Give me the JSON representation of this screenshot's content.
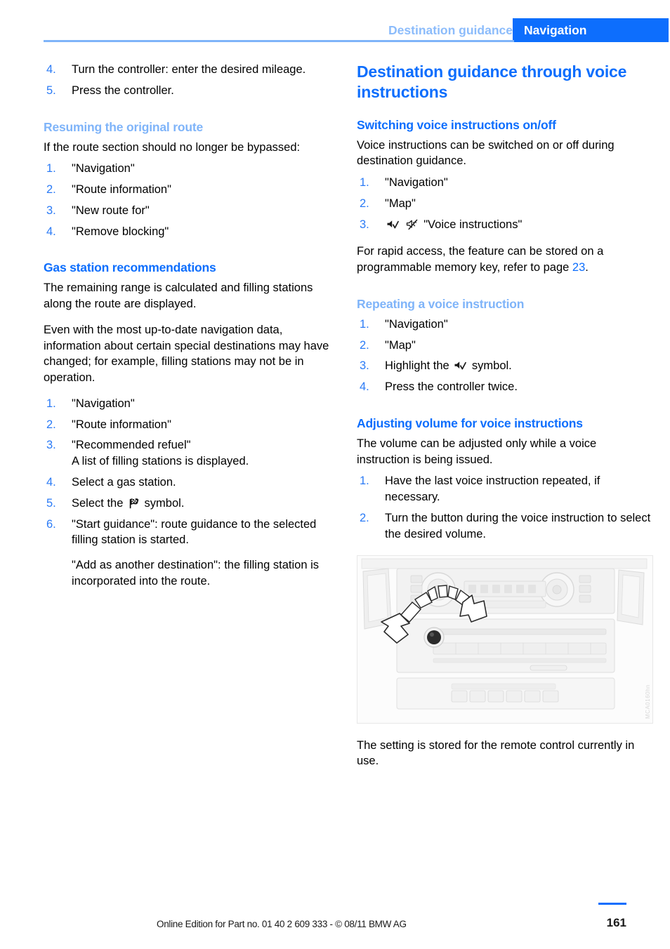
{
  "header": {
    "chapter": "Destination guidance",
    "section": "Navigation",
    "section_bg": "#0d6efd",
    "chapter_color": "#8cbcfb"
  },
  "colors": {
    "heading_blue": "#0d6efd",
    "heading_blue_light": "#7fb4f9",
    "list_number_blue": "#2b7bf6",
    "rule_blue": "#7fb4f9"
  },
  "left_column": {
    "continued_steps": [
      {
        "num": "4.",
        "text": "Turn the controller: enter the desired mileage."
      },
      {
        "num": "5.",
        "text": "Press the controller."
      }
    ],
    "resuming": {
      "heading": "Resuming the original route",
      "intro": "If the route section should no longer be bypassed:",
      "steps": [
        {
          "num": "1.",
          "text": "\"Navigation\""
        },
        {
          "num": "2.",
          "text": "\"Route information\""
        },
        {
          "num": "3.",
          "text": "\"New route for\""
        },
        {
          "num": "4.",
          "text": "\"Remove blocking\""
        }
      ]
    },
    "gas_station": {
      "heading": "Gas station recommendations",
      "para1": "The remaining range is calculated and filling stations along the route are displayed.",
      "para2": "Even with the most up-to-date navigation data, information about certain special destinations may have changed; for example, filling stations may not be in operation.",
      "steps": [
        {
          "num": "1.",
          "text": "\"Navigation\""
        },
        {
          "num": "2.",
          "text": "\"Route information\""
        },
        {
          "num": "3.",
          "text": "\"Recommended refuel\"",
          "sub": "A list of filling stations is displayed."
        },
        {
          "num": "4.",
          "text": "Select a gas station."
        },
        {
          "num": "5.",
          "text_before_icon": "Select the ",
          "icon": "fuel-flag-icon",
          "text_after_icon": " symbol."
        },
        {
          "num": "6.",
          "text": "\"Start guidance\": route guidance to the selected filling station is started.",
          "sub_para": "\"Add as another destination\": the filling station is incorporated into the route."
        }
      ]
    }
  },
  "right_column": {
    "title": "Destination guidance through voice instructions",
    "switching": {
      "heading": "Switching voice instructions on/off",
      "intro": "Voice instructions can be switched on or off during destination guidance.",
      "steps": [
        {
          "num": "1.",
          "text": "\"Navigation\""
        },
        {
          "num": "2.",
          "text": "\"Map\""
        },
        {
          "num": "3.",
          "icons": [
            "speaker-check-icon",
            "speaker-muted-icon"
          ],
          "text_after_icons": "\"Voice instructions\""
        }
      ],
      "note_before_page": "For rapid access, the feature can be stored on a programmable memory key, refer to page ",
      "note_page_ref": "23",
      "note_after_page": "."
    },
    "repeating": {
      "heading": "Repeating a voice instruction",
      "steps": [
        {
          "num": "1.",
          "text": "\"Navigation\""
        },
        {
          "num": "2.",
          "text": "\"Map\""
        },
        {
          "num": "3.",
          "text_before_icon": "Highlight the ",
          "icon": "speaker-check-icon",
          "text_after_icon": " symbol."
        },
        {
          "num": "4.",
          "text": "Press the controller twice."
        }
      ]
    },
    "volume": {
      "heading": "Adjusting volume for voice instructions",
      "intro": "The volume can be adjusted only while a voice instruction is being issued.",
      "steps": [
        {
          "num": "1.",
          "text": "Have the last voice instruction repeated, if necessary."
        },
        {
          "num": "2.",
          "text": "Turn the button during the voice instruction to select the desired volume."
        }
      ],
      "figure": {
        "name": "center-console-volume-knob-illustration",
        "code": "MCA0160hn"
      },
      "after_figure": "The setting is stored for the remote control currently in use."
    }
  },
  "footer": {
    "note": "Online Edition for Part no. 01 40 2 609 333 - © 08/11 BMW AG",
    "page_number": "161"
  }
}
